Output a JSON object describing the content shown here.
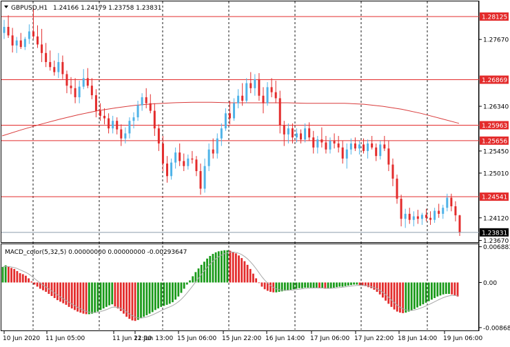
{
  "window": {
    "symbol_label": "GBPUSD,H1",
    "ohlc": "1.24166 1.24179 1.23758 1.23831",
    "indicator_label": "MACD_color(5,32,5) 0.00000000 0.00000000 -0.00293647"
  },
  "colors": {
    "bull": "#4FB3E8",
    "bear": "#E32B2B",
    "level": "#E32B2B",
    "ma": "#D93A3A",
    "hist_up": "#1A9A1A",
    "hist_down": "#E32B2B",
    "signal": "#A8A8A8",
    "grid": "#000000",
    "current_price_line": "#8C9CAC"
  },
  "chart_data": [
    {
      "type": "candlestick",
      "ylim": [
        1.2365,
        1.284
      ],
      "y_ticks": [
        "1.27670",
        "1.26340",
        "1.25450",
        "1.25010",
        "1.24120",
        "1.23670"
      ],
      "x_labels": [
        "10 Jun 2020",
        "11 Jun 05:00",
        "11 Jun 21:00",
        "12 Jun 13:00",
        "15 Jun 06:00",
        "15 Jun 22:00",
        "16 Jun 14:00",
        "17 Jun 06:00",
        "17 Jun 22:00",
        "18 Jun 14:00",
        "19 Jun 06:00"
      ],
      "levels": [
        "1.28125",
        "1.26869",
        "1.25963",
        "1.25656",
        "1.24541"
      ],
      "current_price": "1.23831",
      "ohlc_series": [
        [
          1.278,
          1.2806,
          1.2768,
          1.2792
        ],
        [
          1.2792,
          1.2815,
          1.277,
          1.2775
        ],
        [
          1.2775,
          1.279,
          1.2741,
          1.2755
        ],
        [
          1.2755,
          1.2772,
          1.274,
          1.2765
        ],
        [
          1.2765,
          1.278,
          1.2748,
          1.2752
        ],
        [
          1.2752,
          1.2772,
          1.2746,
          1.2768
        ],
        [
          1.2768,
          1.2797,
          1.2758,
          1.2783
        ],
        [
          1.2783,
          1.283,
          1.2768,
          1.2773
        ],
        [
          1.2773,
          1.2795,
          1.275,
          1.2757
        ],
        [
          1.2757,
          1.2788,
          1.2722,
          1.274
        ],
        [
          1.274,
          1.276,
          1.2712,
          1.2722
        ],
        [
          1.2722,
          1.2745,
          1.2705,
          1.2712
        ],
        [
          1.2712,
          1.2725,
          1.2695,
          1.2702
        ],
        [
          1.2702,
          1.274,
          1.269,
          1.2722
        ],
        [
          1.2722,
          1.2735,
          1.2688,
          1.2698
        ],
        [
          1.2698,
          1.2705,
          1.266,
          1.2675
        ],
        [
          1.2675,
          1.2692,
          1.2658,
          1.267
        ],
        [
          1.267,
          1.269,
          1.264,
          1.2652
        ],
        [
          1.2652,
          1.2685,
          1.264,
          1.2673
        ],
        [
          1.2673,
          1.2708,
          1.2668,
          1.269
        ],
        [
          1.269,
          1.271,
          1.267,
          1.2675
        ],
        [
          1.2675,
          1.269,
          1.2648,
          1.2656
        ],
        [
          1.2656,
          1.2668,
          1.2612,
          1.2625
        ],
        [
          1.2625,
          1.264,
          1.2605,
          1.2615
        ],
        [
          1.2615,
          1.263,
          1.2598,
          1.261
        ],
        [
          1.261,
          1.262,
          1.258,
          1.259
        ],
        [
          1.259,
          1.2615,
          1.258,
          1.2605
        ],
        [
          1.2605,
          1.2612,
          1.2578,
          1.2588
        ],
        [
          1.2588,
          1.2598,
          1.2555,
          1.257
        ],
        [
          1.257,
          1.2592,
          1.256,
          1.258
        ],
        [
          1.258,
          1.2612,
          1.257,
          1.2605
        ],
        [
          1.2605,
          1.2622,
          1.259,
          1.2612
        ],
        [
          1.2612,
          1.2645,
          1.2605,
          1.2636
        ],
        [
          1.2636,
          1.266,
          1.2625,
          1.2652
        ],
        [
          1.2652,
          1.267,
          1.263,
          1.264
        ],
        [
          1.264,
          1.2658,
          1.262,
          1.2625
        ],
        [
          1.2625,
          1.264,
          1.2575,
          1.259
        ],
        [
          1.259,
          1.2598,
          1.2545,
          1.256
        ],
        [
          1.256,
          1.2575,
          1.2505,
          1.252
        ],
        [
          1.252,
          1.2535,
          1.2482,
          1.2495
        ],
        [
          1.2495,
          1.253,
          1.2488,
          1.2522
        ],
        [
          1.2522,
          1.2552,
          1.251,
          1.2542
        ],
        [
          1.2542,
          1.256,
          1.2515,
          1.2525
        ],
        [
          1.2525,
          1.254,
          1.2505,
          1.2515
        ],
        [
          1.2515,
          1.2538,
          1.2508,
          1.253
        ],
        [
          1.253,
          1.2545,
          1.252,
          1.2528
        ],
        [
          1.2528,
          1.2535,
          1.2495,
          1.2505
        ],
        [
          1.2505,
          1.252,
          1.2458,
          1.247
        ],
        [
          1.247,
          1.253,
          1.2462,
          1.2515
        ],
        [
          1.2515,
          1.256,
          1.2505,
          1.2548
        ],
        [
          1.2548,
          1.257,
          1.253,
          1.254
        ],
        [
          1.254,
          1.258,
          1.253,
          1.257
        ],
        [
          1.257,
          1.26,
          1.2555,
          1.259
        ],
        [
          1.259,
          1.263,
          1.2585,
          1.262
        ],
        [
          1.262,
          1.2645,
          1.2598,
          1.261
        ],
        [
          1.261,
          1.265,
          1.2605,
          1.264
        ],
        [
          1.264,
          1.2668,
          1.263,
          1.2655
        ],
        [
          1.2655,
          1.268,
          1.2635,
          1.2645
        ],
        [
          1.2645,
          1.269,
          1.264,
          1.268
        ],
        [
          1.268,
          1.2702,
          1.266,
          1.267
        ],
        [
          1.267,
          1.2698,
          1.2655,
          1.2688
        ],
        [
          1.2688,
          1.27,
          1.2645,
          1.2655
        ],
        [
          1.2655,
          1.2672,
          1.262,
          1.264
        ],
        [
          1.264,
          1.2682,
          1.2635,
          1.2672
        ],
        [
          1.2672,
          1.269,
          1.2652,
          1.2662
        ],
        [
          1.2662,
          1.2685,
          1.264,
          1.265
        ],
        [
          1.265,
          1.2665,
          1.258,
          1.2596
        ],
        [
          1.2596,
          1.2605,
          1.2555,
          1.2578
        ],
        [
          1.2578,
          1.26,
          1.256,
          1.259
        ],
        [
          1.259,
          1.26,
          1.256,
          1.2572
        ],
        [
          1.2572,
          1.259,
          1.2562,
          1.258
        ],
        [
          1.258,
          1.2588,
          1.256,
          1.2568
        ],
        [
          1.2568,
          1.26,
          1.2562,
          1.259
        ],
        [
          1.259,
          1.2602,
          1.2565,
          1.2572
        ],
        [
          1.2572,
          1.2585,
          1.254,
          1.2552
        ],
        [
          1.2552,
          1.2575,
          1.254,
          1.2568
        ],
        [
          1.2568,
          1.2592,
          1.2552,
          1.2562
        ],
        [
          1.2562,
          1.2575,
          1.254,
          1.2548
        ],
        [
          1.2548,
          1.2572,
          1.254,
          1.2565
        ],
        [
          1.2565,
          1.258,
          1.255,
          1.256
        ],
        [
          1.256,
          1.2575,
          1.2542,
          1.2552
        ],
        [
          1.2552,
          1.2565,
          1.252,
          1.253
        ],
        [
          1.253,
          1.256,
          1.251,
          1.2548
        ],
        [
          1.2548,
          1.257,
          1.2538,
          1.256
        ],
        [
          1.256,
          1.2572,
          1.2545,
          1.255
        ],
        [
          1.255,
          1.2565,
          1.2538,
          1.2558
        ],
        [
          1.2558,
          1.257,
          1.254,
          1.2545
        ],
        [
          1.2545,
          1.2568,
          1.253,
          1.256
        ],
        [
          1.256,
          1.2575,
          1.2548,
          1.2552
        ],
        [
          1.2552,
          1.256,
          1.2525,
          1.2535
        ],
        [
          1.2535,
          1.2565,
          1.2528,
          1.2558
        ],
        [
          1.2558,
          1.2575,
          1.2545,
          1.255
        ],
        [
          1.255,
          1.2565,
          1.2505,
          1.2518
        ],
        [
          1.2518,
          1.253,
          1.2475,
          1.249
        ],
        [
          1.249,
          1.2498,
          1.244,
          1.245
        ],
        [
          1.245,
          1.2458,
          1.2395,
          1.241
        ],
        [
          1.241,
          1.243,
          1.2392,
          1.242
        ],
        [
          1.242,
          1.2432,
          1.24,
          1.2408
        ],
        [
          1.2408,
          1.2425,
          1.2395,
          1.2415
        ],
        [
          1.2415,
          1.2428,
          1.24,
          1.241
        ],
        [
          1.241,
          1.2422,
          1.2398,
          1.2418
        ],
        [
          1.2418,
          1.243,
          1.2405,
          1.2412
        ],
        [
          1.2412,
          1.2425,
          1.2398,
          1.2408
        ],
        [
          1.2408,
          1.2432,
          1.2402,
          1.2426
        ],
        [
          1.2426,
          1.244,
          1.2412,
          1.242
        ],
        [
          1.242,
          1.2438,
          1.241,
          1.2432
        ],
        [
          1.2432,
          1.246,
          1.2425,
          1.2452
        ],
        [
          1.2452,
          1.246,
          1.2425,
          1.2435
        ],
        [
          1.2435,
          1.2445,
          1.2405,
          1.2417
        ],
        [
          1.2417,
          1.2418,
          1.2376,
          1.2383
        ]
      ],
      "ma_series": [
        1.2575,
        1.2587,
        1.2598,
        1.2608,
        1.2617,
        1.2625,
        1.2631,
        1.2636,
        1.2639,
        1.2641,
        1.2642,
        1.2642,
        1.2641,
        1.2641,
        1.2641,
        1.2641,
        1.264,
        1.264,
        1.264,
        1.2638,
        1.2634,
        1.2628,
        1.262,
        1.261,
        1.26
      ],
      "ma_label": "",
      "xlabel": "",
      "ylabel": ""
    },
    {
      "type": "bar",
      "title": "MACD_color(5,32,5)",
      "ylim": [
        -0.0091,
        0.0071
      ],
      "y_ticks": [
        "0.0068832",
        "0.00",
        "-0.008685"
      ],
      "hist_series": [
        0.003,
        0.0033,
        0.003,
        0.0028,
        0.0026,
        0.0022,
        0.0018,
        0.0016,
        0.0013,
        0.0008,
        0.0002,
        -0.0004,
        -0.0008,
        -0.0012,
        -0.0015,
        -0.0018,
        -0.0022,
        -0.0026,
        -0.003,
        -0.0034,
        -0.0037,
        -0.004,
        -0.0043,
        -0.0047,
        -0.005,
        -0.0053,
        -0.0056,
        -0.0058,
        -0.006,
        -0.0061,
        -0.0061,
        -0.006,
        -0.0058,
        -0.0056,
        -0.0053,
        -0.005,
        -0.0047,
        -0.0044,
        -0.0042,
        -0.0046,
        -0.005,
        -0.0055,
        -0.006,
        -0.0066,
        -0.007,
        -0.0073,
        -0.0074,
        -0.0072,
        -0.0069,
        -0.0066,
        -0.0063,
        -0.006,
        -0.0057,
        -0.0053,
        -0.005,
        -0.0047,
        -0.0045,
        -0.0043,
        -0.0041,
        -0.0038,
        -0.0033,
        -0.0027,
        -0.002,
        -0.0012,
        -0.0004,
        0.0004,
        0.0012,
        0.002,
        0.0027,
        0.0034,
        0.004,
        0.0046,
        0.0051,
        0.0055,
        0.0058,
        0.006,
        0.0061,
        0.0062,
        0.0062,
        0.0061,
        0.0059,
        0.0056,
        0.0052,
        0.0047,
        0.0041,
        0.0034,
        0.0026,
        0.0017,
        0.0008,
        -0.0001,
        -0.0008,
        -0.0013,
        -0.0016,
        -0.0018,
        -0.0019,
        -0.0019,
        -0.0018,
        -0.0017,
        -0.0016,
        -0.0015,
        -0.0014,
        -0.0013,
        -0.0012,
        -0.0011,
        -0.0011,
        -0.001,
        -0.001,
        -0.001,
        -0.001,
        -0.001,
        -0.0011,
        -0.0011,
        -0.0012,
        -0.0012,
        -0.0011,
        -0.001,
        -0.0009,
        -0.0008,
        -0.0008,
        -0.0007,
        -0.0006,
        -0.0005,
        -0.0004,
        -0.0004,
        -0.0005,
        -0.0006,
        -0.0007,
        -0.0009,
        -0.0011,
        -0.0014,
        -0.0018,
        -0.0023,
        -0.0029,
        -0.0035,
        -0.0041,
        -0.0047,
        -0.0052,
        -0.0056,
        -0.0058,
        -0.0059,
        -0.0058,
        -0.0056,
        -0.0054,
        -0.0051,
        -0.0048,
        -0.0045,
        -0.0042,
        -0.0039,
        -0.0036,
        -0.0033,
        -0.003,
        -0.0027,
        -0.0025,
        -0.0023,
        -0.0022,
        -0.0022,
        -0.0023,
        -0.0025,
        -0.0027
      ],
      "xlabel": "",
      "ylabel": ""
    }
  ]
}
